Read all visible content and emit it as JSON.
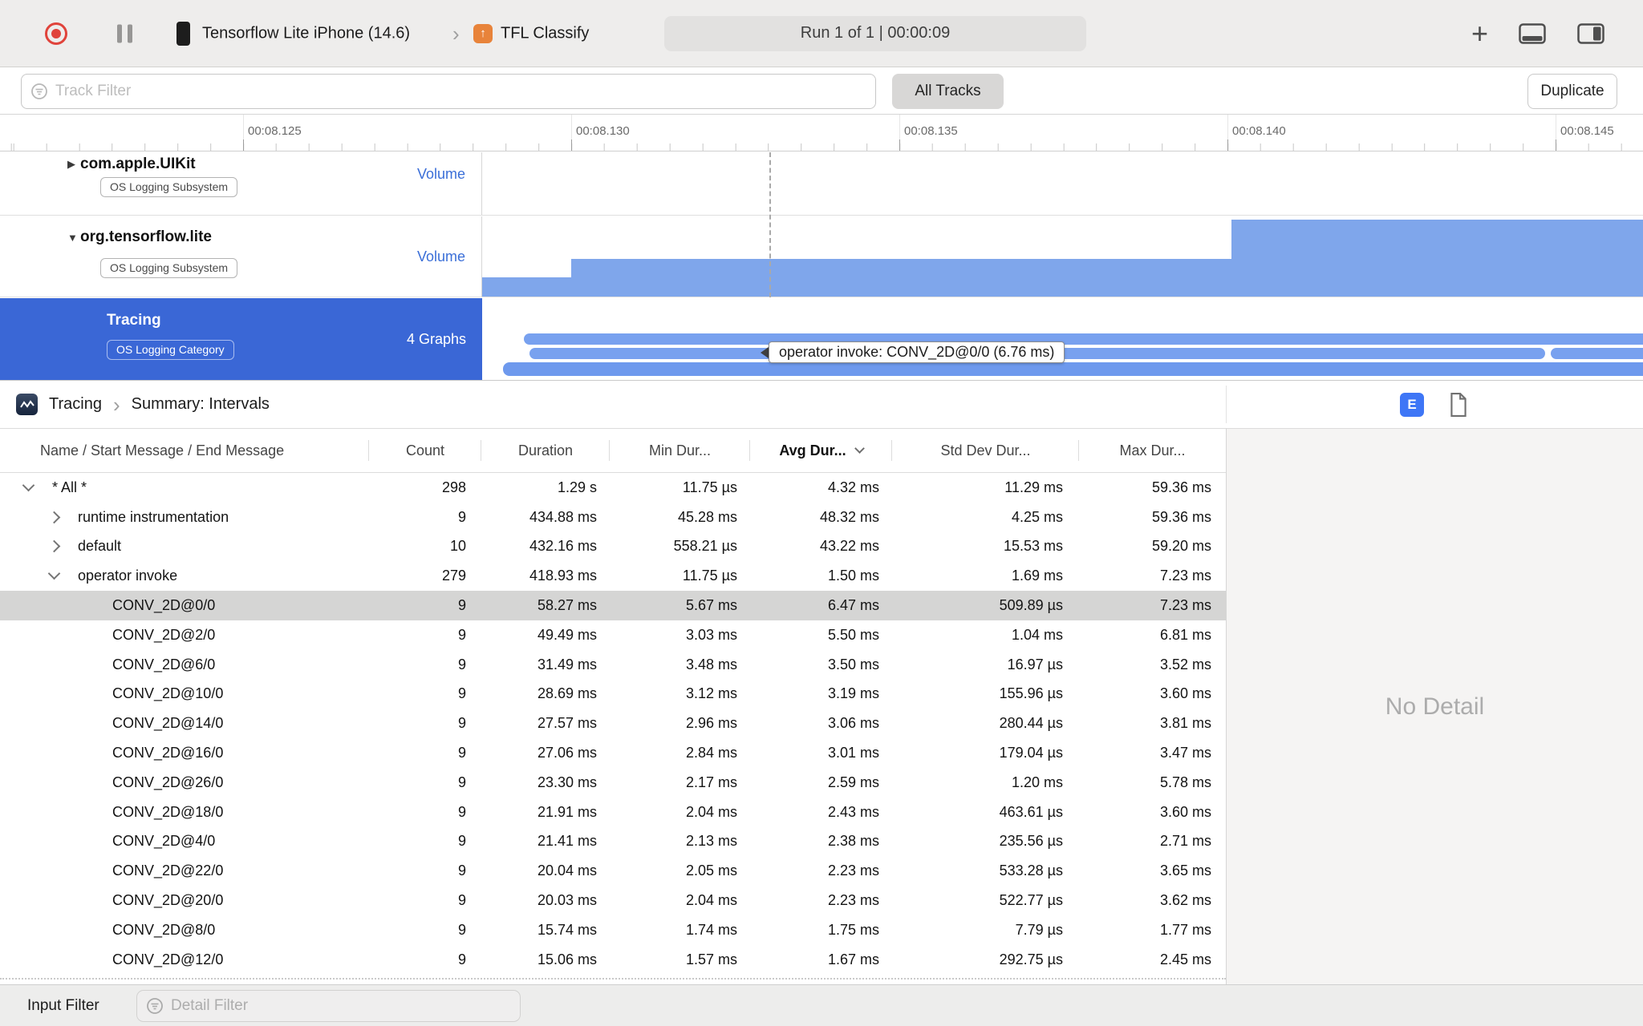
{
  "toolbar": {
    "device_name": "Tensorflow Lite iPhone (14.6)",
    "target_name": "TFL Classify",
    "run_status": "Run 1 of 1  |  00:00:09"
  },
  "filter_bar": {
    "track_filter_placeholder": "Track Filter",
    "all_tracks": "All Tracks",
    "duplicate": "Duplicate"
  },
  "ruler": {
    "labels": [
      "00:08.125",
      "00:08.130",
      "00:08.135",
      "00:08.140",
      "00:08.145"
    ]
  },
  "tracks": [
    {
      "name": "com.apple.UIKit",
      "badge": "OS Logging Subsystem",
      "detail": "Volume"
    },
    {
      "name": "org.tensorflow.lite",
      "badge": "OS Logging Subsystem",
      "detail": "Volume"
    },
    {
      "name": "Tracing",
      "badge": "OS Logging Category",
      "detail": "4 Graphs"
    }
  ],
  "timeline_tooltip": "operator invoke: CONV_2D@0/0 (6.76 ms)",
  "detail_panel": {
    "breadcrumb_instrument": "Tracing",
    "breadcrumb_view": "Summary: Intervals",
    "extended_detail_button": "E",
    "no_detail": "No Detail"
  },
  "table": {
    "columns": {
      "name": "Name / Start Message / End Message",
      "count": "Count",
      "duration": "Duration",
      "min": "Min Dur...",
      "avg": "Avg Dur...",
      "std": "Std Dev Dur...",
      "max": "Max Dur..."
    },
    "rows": [
      {
        "indent": 0,
        "chevron": "down",
        "name": "* All *",
        "count": "298",
        "duration": "1.29 s",
        "min": "11.75 µs",
        "avg": "4.32 ms",
        "std": "11.29 ms",
        "max": "59.36 ms",
        "selected": false
      },
      {
        "indent": 1,
        "chevron": "right",
        "name": "runtime instrumentation",
        "count": "9",
        "duration": "434.88 ms",
        "min": "45.28 ms",
        "avg": "48.32 ms",
        "std": "4.25 ms",
        "max": "59.36 ms",
        "selected": false
      },
      {
        "indent": 1,
        "chevron": "right",
        "name": "default",
        "count": "10",
        "duration": "432.16 ms",
        "min": "558.21 µs",
        "avg": "43.22 ms",
        "std": "15.53 ms",
        "max": "59.20 ms",
        "selected": false
      },
      {
        "indent": 1,
        "chevron": "down",
        "name": "operator invoke",
        "count": "279",
        "duration": "418.93 ms",
        "min": "11.75 µs",
        "avg": "1.50 ms",
        "std": "1.69 ms",
        "max": "7.23 ms",
        "selected": false
      },
      {
        "indent": 2,
        "chevron": "none",
        "name": "CONV_2D@0/0",
        "count": "9",
        "duration": "58.27 ms",
        "min": "5.67 ms",
        "avg": "6.47 ms",
        "std": "509.89 µs",
        "max": "7.23 ms",
        "selected": true
      },
      {
        "indent": 2,
        "chevron": "none",
        "name": "CONV_2D@2/0",
        "count": "9",
        "duration": "49.49 ms",
        "min": "3.03 ms",
        "avg": "5.50 ms",
        "std": "1.04 ms",
        "max": "6.81 ms",
        "selected": false
      },
      {
        "indent": 2,
        "chevron": "none",
        "name": "CONV_2D@6/0",
        "count": "9",
        "duration": "31.49 ms",
        "min": "3.48 ms",
        "avg": "3.50 ms",
        "std": "16.97 µs",
        "max": "3.52 ms",
        "selected": false
      },
      {
        "indent": 2,
        "chevron": "none",
        "name": "CONV_2D@10/0",
        "count": "9",
        "duration": "28.69 ms",
        "min": "3.12 ms",
        "avg": "3.19 ms",
        "std": "155.96 µs",
        "max": "3.60 ms",
        "selected": false
      },
      {
        "indent": 2,
        "chevron": "none",
        "name": "CONV_2D@14/0",
        "count": "9",
        "duration": "27.57 ms",
        "min": "2.96 ms",
        "avg": "3.06 ms",
        "std": "280.44 µs",
        "max": "3.81 ms",
        "selected": false
      },
      {
        "indent": 2,
        "chevron": "none",
        "name": "CONV_2D@16/0",
        "count": "9",
        "duration": "27.06 ms",
        "min": "2.84 ms",
        "avg": "3.01 ms",
        "std": "179.04 µs",
        "max": "3.47 ms",
        "selected": false
      },
      {
        "indent": 2,
        "chevron": "none",
        "name": "CONV_2D@26/0",
        "count": "9",
        "duration": "23.30 ms",
        "min": "2.17 ms",
        "avg": "2.59 ms",
        "std": "1.20 ms",
        "max": "5.78 ms",
        "selected": false
      },
      {
        "indent": 2,
        "chevron": "none",
        "name": "CONV_2D@18/0",
        "count": "9",
        "duration": "21.91 ms",
        "min": "2.04 ms",
        "avg": "2.43 ms",
        "std": "463.61 µs",
        "max": "3.60 ms",
        "selected": false
      },
      {
        "indent": 2,
        "chevron": "none",
        "name": "CONV_2D@4/0",
        "count": "9",
        "duration": "21.41 ms",
        "min": "2.13 ms",
        "avg": "2.38 ms",
        "std": "235.56 µs",
        "max": "2.71 ms",
        "selected": false
      },
      {
        "indent": 2,
        "chevron": "none",
        "name": "CONV_2D@22/0",
        "count": "9",
        "duration": "20.04 ms",
        "min": "2.05 ms",
        "avg": "2.23 ms",
        "std": "533.28 µs",
        "max": "3.65 ms",
        "selected": false
      },
      {
        "indent": 2,
        "chevron": "none",
        "name": "CONV_2D@20/0",
        "count": "9",
        "duration": "20.03 ms",
        "min": "2.04 ms",
        "avg": "2.23 ms",
        "std": "522.77 µs",
        "max": "3.62 ms",
        "selected": false
      },
      {
        "indent": 2,
        "chevron": "none",
        "name": "CONV_2D@8/0",
        "count": "9",
        "duration": "15.74 ms",
        "min": "1.74 ms",
        "avg": "1.75 ms",
        "std": "7.79 µs",
        "max": "1.77 ms",
        "selected": false
      },
      {
        "indent": 2,
        "chevron": "none",
        "name": "CONV_2D@12/0",
        "count": "9",
        "duration": "15.06 ms",
        "min": "1.57 ms",
        "avg": "1.67 ms",
        "std": "292.75 µs",
        "max": "2.45 ms",
        "selected": false
      }
    ]
  },
  "bottom_bar": {
    "input_filter": "Input Filter",
    "detail_filter_placeholder": "Detail Filter"
  }
}
